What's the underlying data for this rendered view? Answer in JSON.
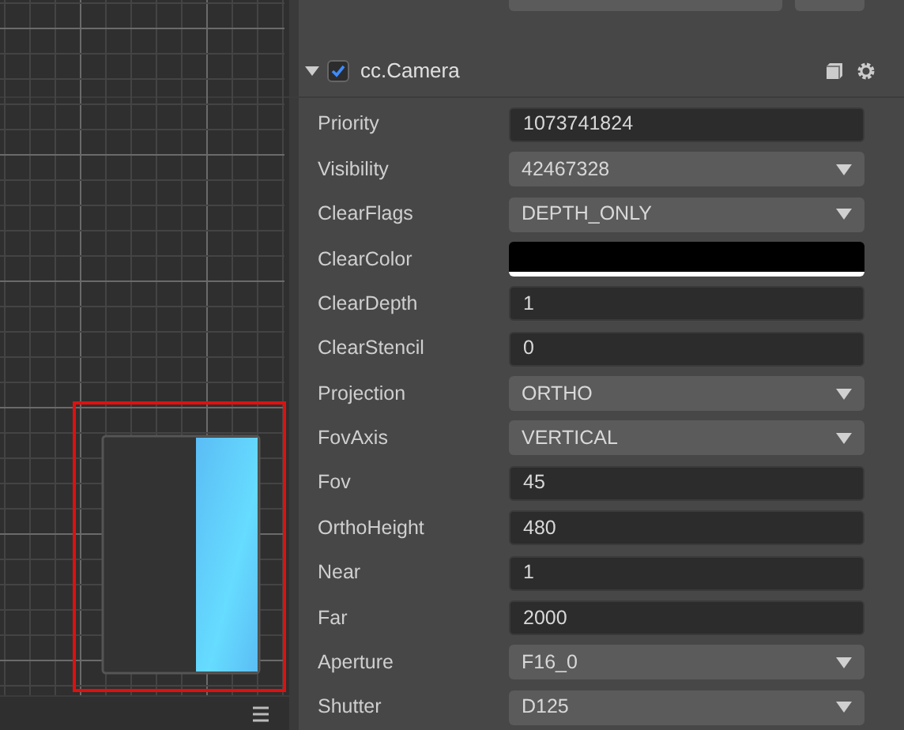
{
  "component": {
    "title": "cc.Camera",
    "expanded": true,
    "enabled": true
  },
  "properties": [
    {
      "label": "Priority",
      "kind": "input",
      "value": "1073741824"
    },
    {
      "label": "Visibility",
      "kind": "select",
      "value": "42467328"
    },
    {
      "label": "ClearFlags",
      "kind": "select",
      "value": "DEPTH_ONLY"
    },
    {
      "label": "ClearColor",
      "kind": "color",
      "color": "#000000"
    },
    {
      "label": "ClearDepth",
      "kind": "input",
      "value": "1"
    },
    {
      "label": "ClearStencil",
      "kind": "input",
      "value": "0"
    },
    {
      "label": "Projection",
      "kind": "select",
      "value": "ORTHO"
    },
    {
      "label": "FovAxis",
      "kind": "select",
      "value": "VERTICAL"
    },
    {
      "label": "Fov",
      "kind": "input",
      "value": "45"
    },
    {
      "label": "OrthoHeight",
      "kind": "input",
      "value": "480"
    },
    {
      "label": "Near",
      "kind": "input",
      "value": "1"
    },
    {
      "label": "Far",
      "kind": "input",
      "value": "2000"
    },
    {
      "label": "Aperture",
      "kind": "select",
      "value": "F16_0"
    },
    {
      "label": "Shutter",
      "kind": "select",
      "value": "D125"
    }
  ]
}
